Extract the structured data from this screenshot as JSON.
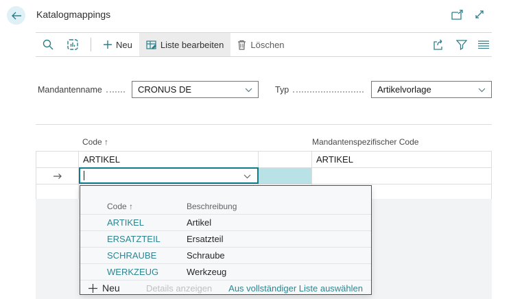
{
  "page": {
    "title": "Katalogmappings"
  },
  "toolbar": {
    "new": "Neu",
    "edit_list": "Liste bearbeiten",
    "delete": "Löschen"
  },
  "filters": {
    "mandant": {
      "label": "Mandantenname",
      "value": "CRONUS DE"
    },
    "typ": {
      "label": "Typ",
      "value": "Artikelvorlage"
    }
  },
  "grid": {
    "col_code": "Code ↑",
    "col_mandant": "Mandantenspezifischer Code",
    "rows": [
      {
        "code": "ARTIKEL",
        "mandant_code": "ARTIKEL"
      }
    ],
    "edit_row": {
      "code_value": ""
    }
  },
  "dropdown": {
    "col_code": "Code ↑",
    "col_desc": "Beschreibung",
    "items": [
      {
        "code": "ARTIKEL",
        "desc": "Artikel"
      },
      {
        "code": "ERSATZTEIL",
        "desc": "Ersatzteil"
      },
      {
        "code": "SCHRAUBE",
        "desc": "Schraube"
      },
      {
        "code": "WERKZEUG",
        "desc": "Werkzeug"
      }
    ],
    "new": "Neu",
    "details": "Details anzeigen",
    "select_full": "Aus vollständiger Liste auswählen"
  },
  "colors": {
    "accent_teal": "#2b7f8a",
    "link_teal": "#2b8591",
    "selected_cell": "#b9e2e6",
    "edit_border": "#0e7c87",
    "back_circle": "#dff0f6",
    "panel_bg": "#f7f8f9",
    "filler_bg": "#f2f3f5"
  }
}
